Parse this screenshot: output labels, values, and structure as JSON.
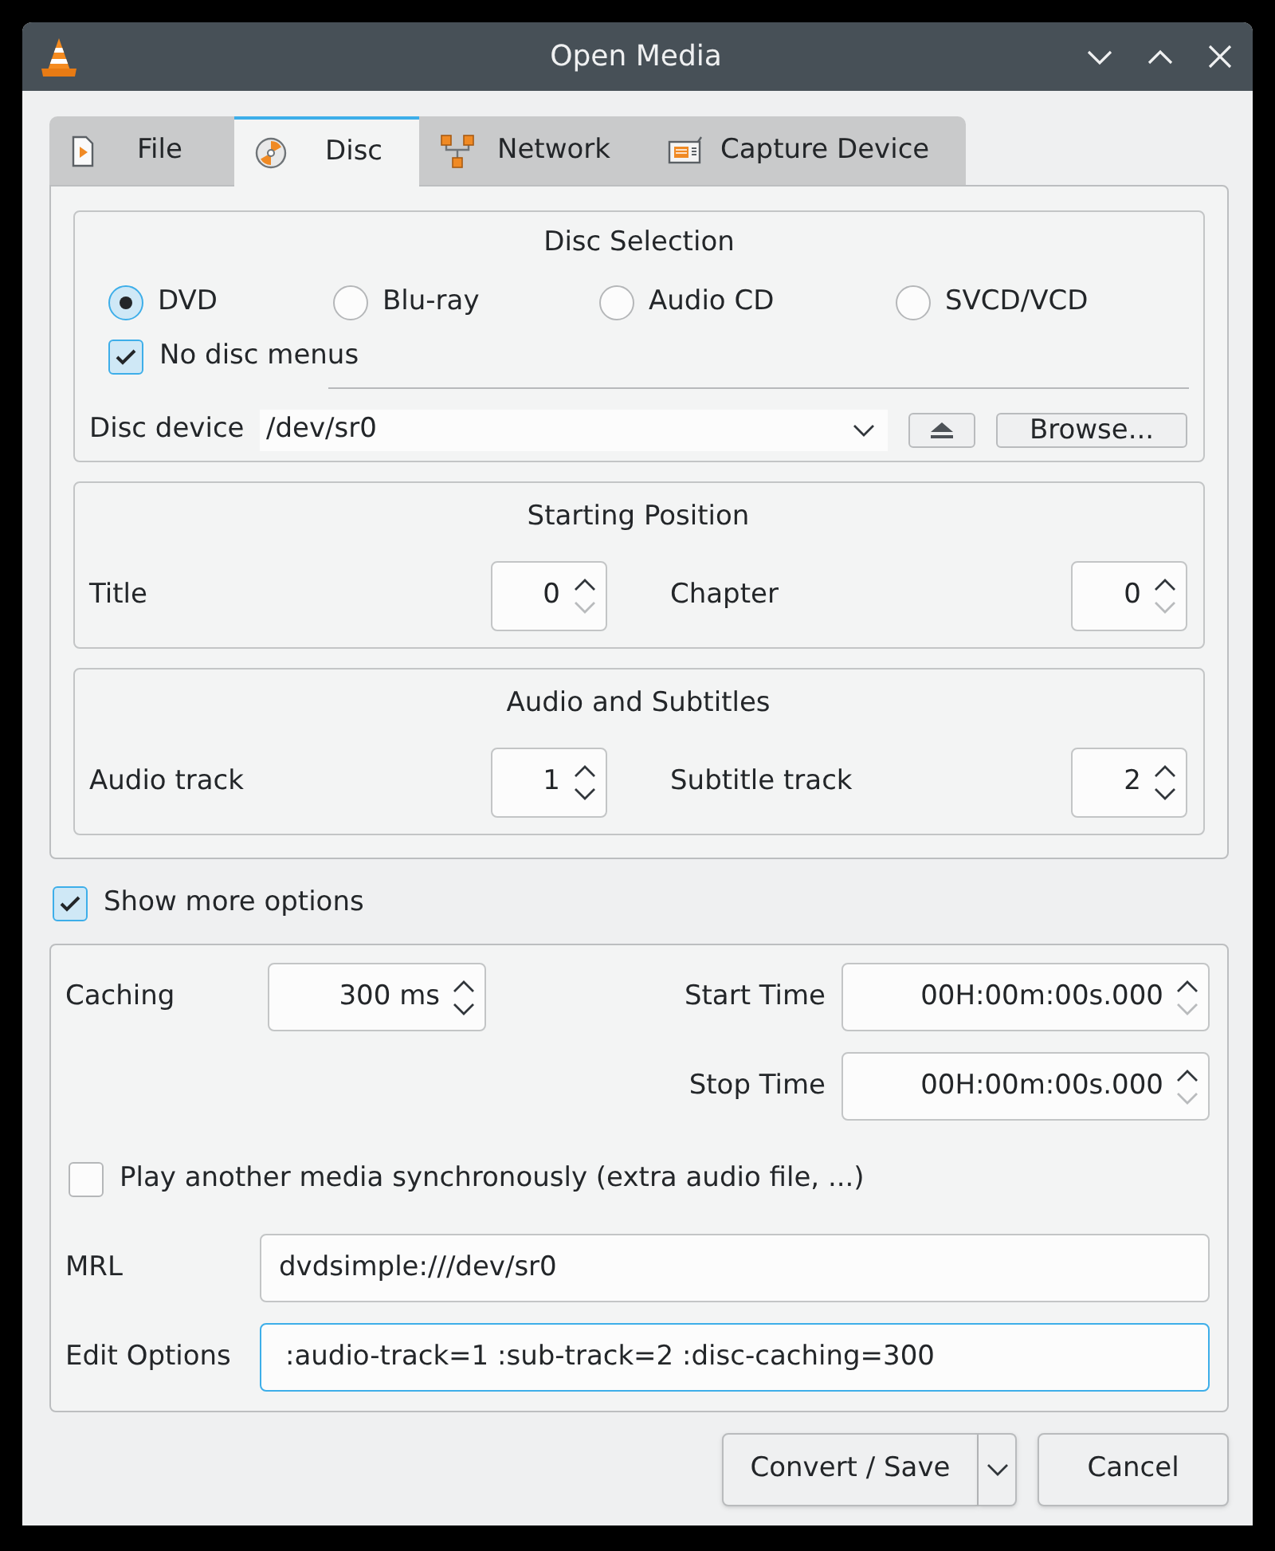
{
  "window": {
    "title": "Open Media"
  },
  "tabs": [
    {
      "label": "File",
      "selected": false
    },
    {
      "label": "Disc",
      "selected": true
    },
    {
      "label": "Network",
      "selected": false
    },
    {
      "label": "Capture Device",
      "selected": false
    }
  ],
  "disc_selection": {
    "title": "Disc Selection",
    "disc_types": [
      {
        "label": "DVD",
        "selected": true
      },
      {
        "label": "Blu-ray",
        "selected": false
      },
      {
        "label": "Audio CD",
        "selected": false
      },
      {
        "label": "SVCD/VCD",
        "selected": false
      }
    ],
    "no_disc_menus": {
      "label": "No disc menus",
      "checked": true
    },
    "device": {
      "label": "Disc device",
      "value": "/dev/sr0"
    },
    "browse_button": "Browse..."
  },
  "starting_position": {
    "title": "Starting Position",
    "fields": [
      {
        "label": "Title",
        "value": "0",
        "decrement_disabled": true
      },
      {
        "label": "Chapter",
        "value": "0",
        "decrement_disabled": true
      }
    ]
  },
  "audio_subtitles": {
    "title": "Audio and Subtitles",
    "fields": [
      {
        "label": "Audio track",
        "value": "1",
        "decrement_disabled": false
      },
      {
        "label": "Subtitle track",
        "value": "2",
        "decrement_disabled": false
      }
    ]
  },
  "show_more_options": {
    "label": "Show more options",
    "checked": true
  },
  "options": {
    "caching": {
      "label": "Caching",
      "value": "300 ms",
      "decrement_disabled": false
    },
    "start_time": {
      "label": "Start Time",
      "value": "00H:00m:00s.000",
      "decrement_disabled": true
    },
    "stop_time": {
      "label": "Stop Time",
      "value": "00H:00m:00s.000",
      "decrement_disabled": true
    },
    "play_another": {
      "label": "Play another media synchronously (extra audio file, ...)",
      "checked": false
    },
    "mrl": {
      "label": "MRL",
      "value": "dvdsimple:///dev/sr0",
      "focused": false
    },
    "edit_options": {
      "label": "Edit Options",
      "value": ":audio-track=1 :sub-track=2 :disc-caching=300",
      "focused": true
    }
  },
  "buttons": [
    {
      "label": "Convert / Save",
      "kind": "split"
    },
    {
      "label": "Cancel",
      "kind": "plain"
    }
  ]
}
